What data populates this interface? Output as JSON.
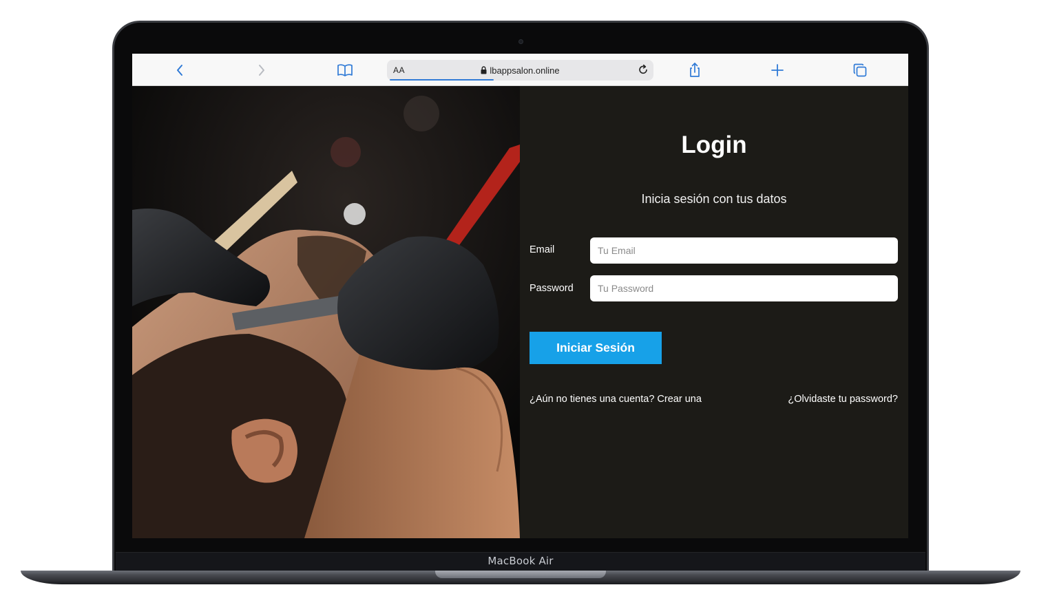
{
  "device": {
    "model_label": "MacBook Air"
  },
  "browser": {
    "address_bar": {
      "text_size_label": "AA",
      "url": "lbappsalon.online"
    },
    "icons": {
      "back": "chevron-left-icon",
      "forward": "chevron-right-icon",
      "bookmarks": "book-icon",
      "lock": "lock-icon",
      "reload": "reload-icon",
      "share": "share-icon",
      "new_tab": "plus-icon",
      "tabs": "tabs-icon"
    }
  },
  "hero": {
    "image_alt": "barber-shaving-photo"
  },
  "login": {
    "title": "Login",
    "subtitle": "Inicia sesión con tus datos",
    "email": {
      "label": "Email",
      "placeholder": "Tu Email",
      "value": ""
    },
    "password": {
      "label": "Password",
      "placeholder": "Tu Password",
      "value": ""
    },
    "submit_label": "Iniciar Sesión",
    "create_account_link": "¿Aún no tienes una cuenta? Crear una",
    "forgot_password_link": "¿Olvidaste tu password?"
  },
  "colors": {
    "panel_bg": "#1c1b17",
    "button_bg": "#17a1e8",
    "browser_accent": "#2f7ad6"
  }
}
